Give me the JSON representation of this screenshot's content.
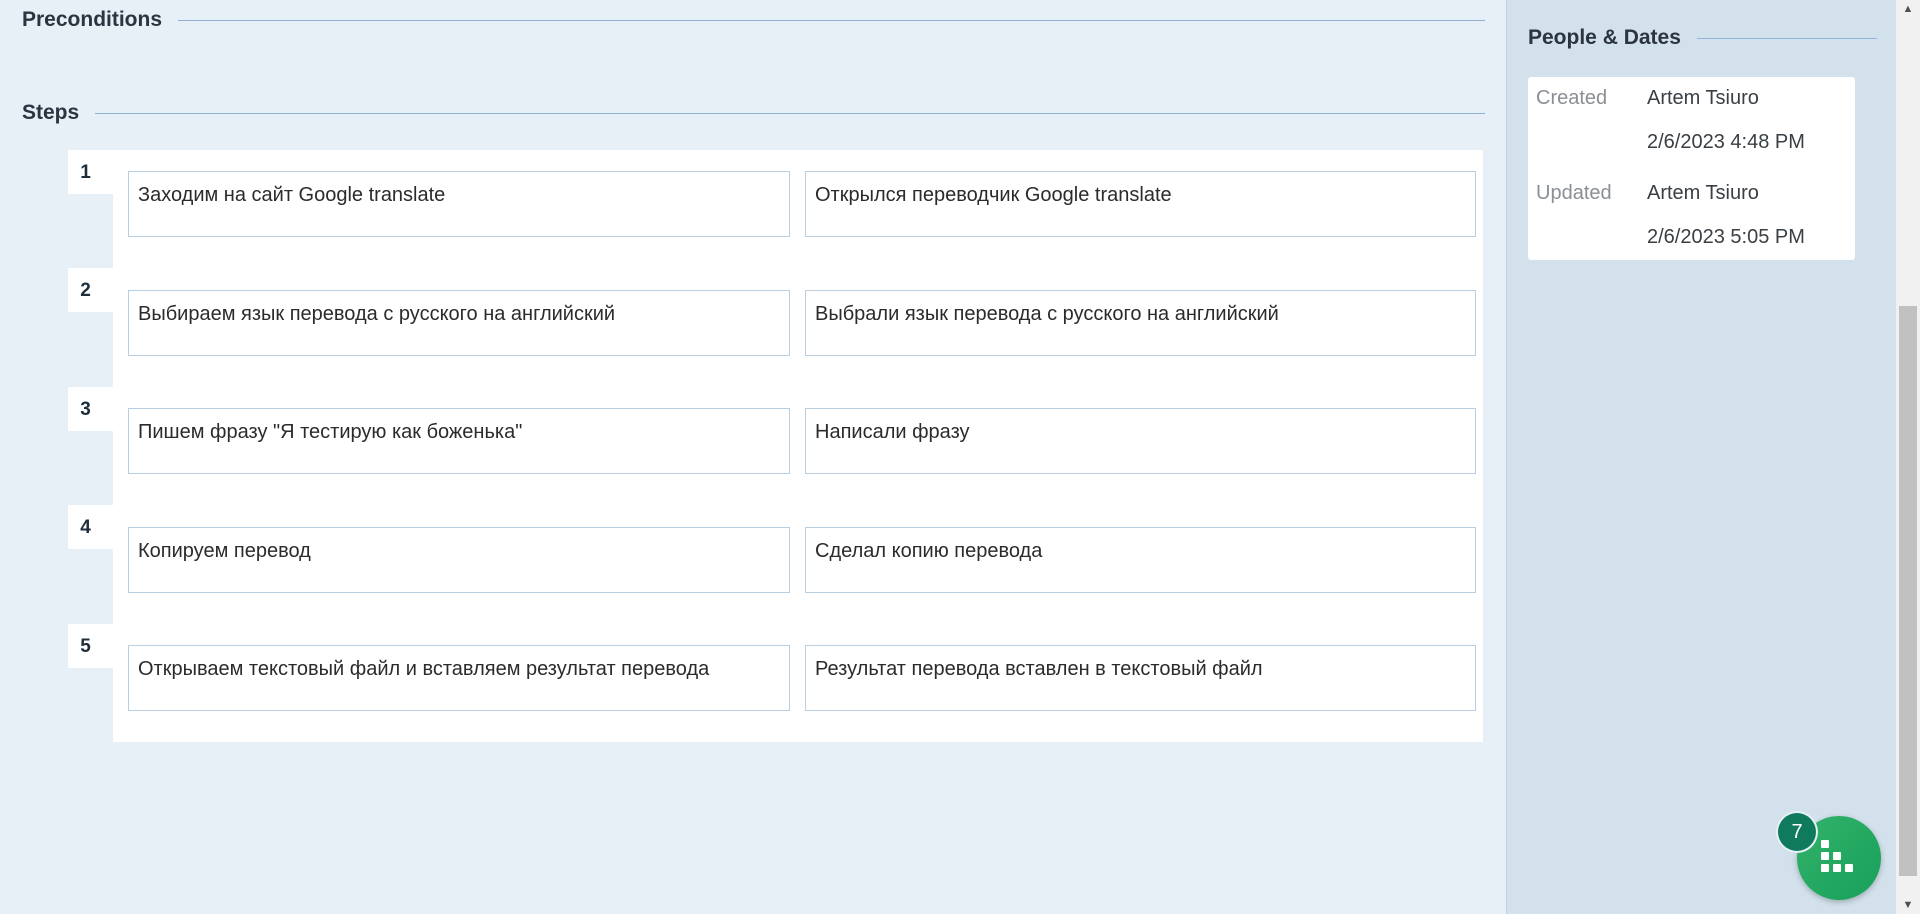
{
  "preconditions": {
    "title": "Preconditions"
  },
  "steps": {
    "title": "Steps",
    "items": [
      {
        "number": "1",
        "action": "Заходим на сайт Google translate",
        "result": "Открылся переводчик Google translate"
      },
      {
        "number": "2",
        "action": "Выбираем язык перевода с русского на английский",
        "result": "Выбрали язык перевода с русского на английский"
      },
      {
        "number": "3",
        "action": "Пишем фразу \"Я тестирую как боженька\"",
        "result": "Написали фразу"
      },
      {
        "number": "4",
        "action": "Копируем перевод",
        "result": "Сделал копию перевода"
      },
      {
        "number": "5",
        "action": "Открываем текстовый файл и вставляем результат перевода",
        "result": "Результат перевода вставлен в текстовый файл"
      }
    ]
  },
  "people_dates": {
    "title": "People & Dates",
    "created_label": "Created",
    "created_by": "Artem Tsiuro",
    "created_at": "2/6/2023 4:48 PM",
    "updated_label": "Updated",
    "updated_by": "Artem Tsiuro",
    "updated_at": "2/6/2023 5:05 PM"
  },
  "fab": {
    "badge": "7",
    "icon": "grid-chart-icon",
    "color": "#22a862"
  }
}
